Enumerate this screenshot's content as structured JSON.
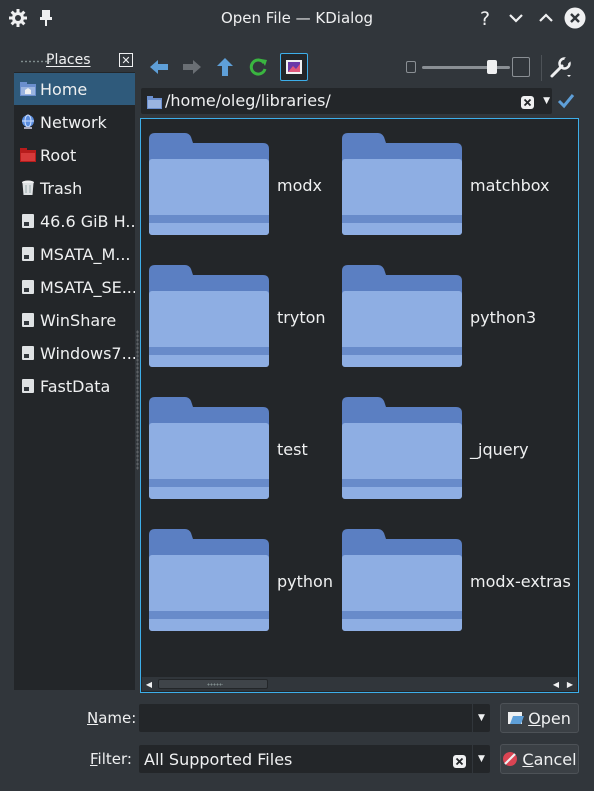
{
  "window": {
    "title": "Open File — KDialog"
  },
  "titlebar": {
    "left_icons": [
      "gear-icon",
      "pin-icon"
    ],
    "right_icons": [
      "help-icon",
      "minimize-icon",
      "maximize-icon",
      "close-icon"
    ]
  },
  "places": {
    "header": "Places",
    "items": [
      {
        "label": "Home",
        "icon": "home-folder-icon",
        "selected": true
      },
      {
        "label": "Network",
        "icon": "network-icon",
        "selected": false
      },
      {
        "label": "Root",
        "icon": "root-folder-icon",
        "selected": false
      },
      {
        "label": "Trash",
        "icon": "trash-icon",
        "selected": false
      },
      {
        "label": "46.6 GiB H...",
        "icon": "drive-icon",
        "selected": false
      },
      {
        "label": "MSATA_M...",
        "icon": "drive-icon",
        "selected": false
      },
      {
        "label": "MSATA_SE...",
        "icon": "drive-icon",
        "selected": false
      },
      {
        "label": "WinShare",
        "icon": "drive-icon",
        "selected": false
      },
      {
        "label": "Windows7...",
        "icon": "drive-icon",
        "selected": false
      },
      {
        "label": "FastData",
        "icon": "drive-icon",
        "selected": false
      }
    ]
  },
  "toolbar": {
    "buttons": [
      "back-arrow-icon",
      "forward-arrow-icon",
      "up-arrow-icon",
      "reload-icon",
      "preview-icon"
    ],
    "settings_icon": "wrench-icon",
    "zoom_level": 0.8
  },
  "path": {
    "value": "/home/oleg/libraries/"
  },
  "files": [
    {
      "name": "modx"
    },
    {
      "name": "matchbox"
    },
    {
      "name": "tryton"
    },
    {
      "name": "python3"
    },
    {
      "name": "test"
    },
    {
      "name": "_jquery"
    },
    {
      "name": "python"
    },
    {
      "name": "modx-extras"
    }
  ],
  "name_row": {
    "label": "Name:",
    "value": ""
  },
  "filter_row": {
    "label": "Filter:",
    "value": "All Supported Files"
  },
  "buttons": {
    "open": "Open",
    "cancel": "Cancel"
  },
  "colors": {
    "accent": "#3daee9",
    "window_bg": "#31363b",
    "view_bg": "#232629",
    "selection": "#2f5a7b",
    "folder": "#6b8fce"
  }
}
